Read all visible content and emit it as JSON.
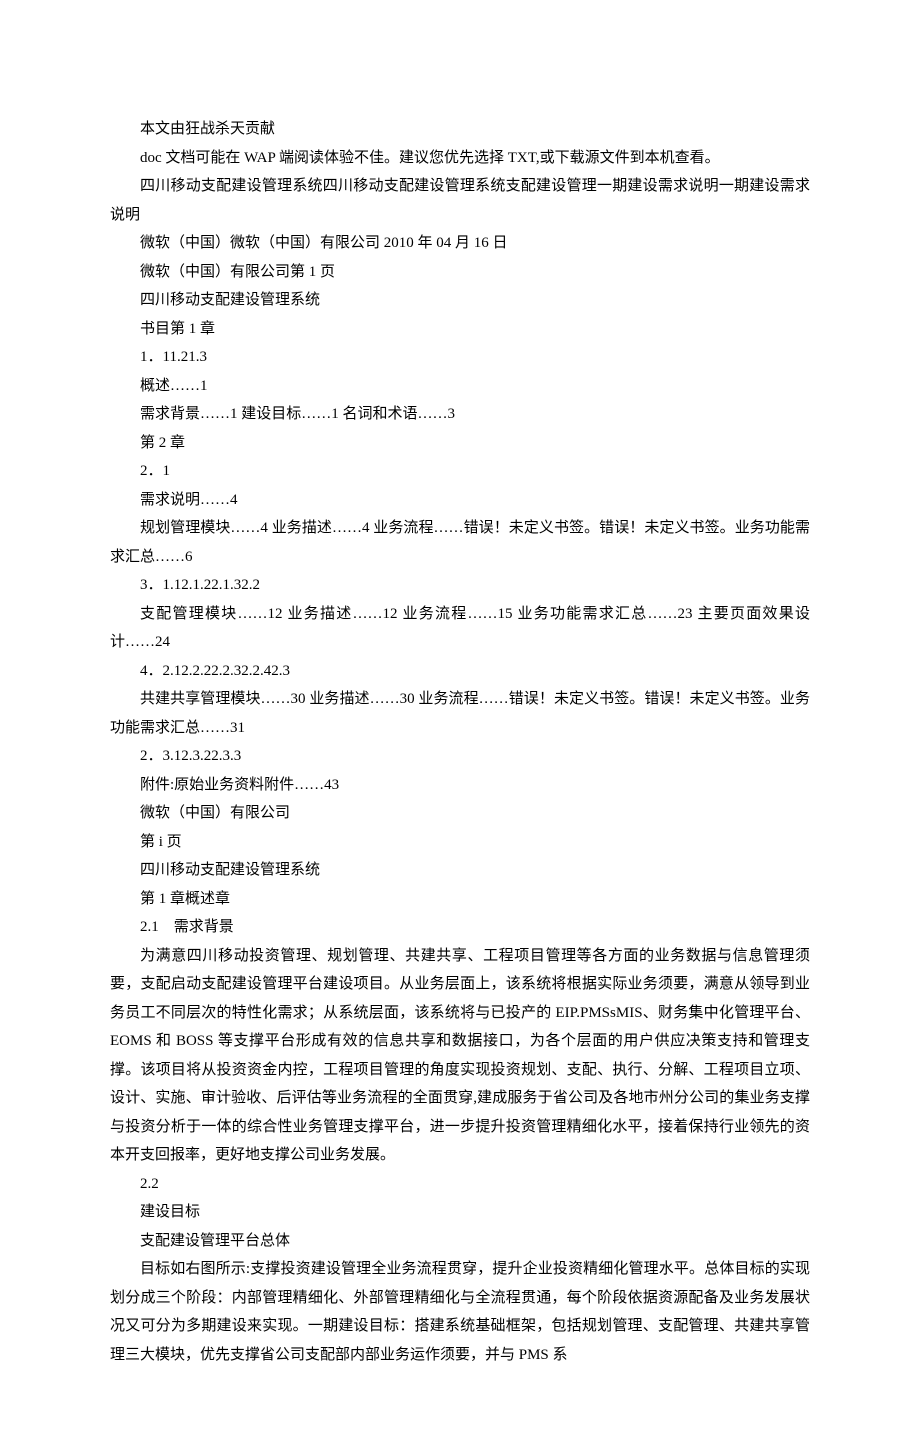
{
  "lines": [
    {
      "indent": true,
      "text": "本文由狂战杀天贡献"
    },
    {
      "indent": true,
      "text": "doc 文档可能在 WAP 端阅读体验不佳。建议您优先选择 TXT,或下载源文件到本机查看。"
    },
    {
      "indent": true,
      "text": "四川移动支配建设管理系统四川移动支配建设管理系统支配建设管理一期建设需求说明一期建设需求说明"
    },
    {
      "indent": true,
      "text": "微软（中国）微软（中国）有限公司 2010 年 04 月 16 日"
    },
    {
      "indent": true,
      "text": "微软（中国）有限公司第 1 页"
    },
    {
      "indent": true,
      "text": "四川移动支配建设管理系统"
    },
    {
      "indent": true,
      "text": "书目第 1 章"
    },
    {
      "indent": true,
      "text": "1．11.21.3"
    },
    {
      "indent": true,
      "text": "概述……1"
    },
    {
      "indent": true,
      "text": "需求背景……1 建设目标……1 名词和术语……3"
    },
    {
      "indent": true,
      "text": "第 2 章"
    },
    {
      "indent": true,
      "text": "2．1"
    },
    {
      "indent": true,
      "text": "需求说明……4"
    },
    {
      "indent": true,
      "text": "规划管理模块……4 业务描述……4 业务流程……错误！未定义书签。错误！未定义书签。业务功能需求汇总……6"
    },
    {
      "indent": true,
      "text": "3．1.12.1.22.1.32.2"
    },
    {
      "indent": true,
      "text": "支配管理模块……12 业务描述……12 业务流程……15 业务功能需求汇总……23 主要页面效果设计……24"
    },
    {
      "indent": true,
      "text": "4．2.12.2.22.2.32.2.42.3"
    },
    {
      "indent": true,
      "text": "共建共享管理模块……30 业务描述……30 业务流程……错误！未定义书签。错误！未定义书签。业务功能需求汇总……31"
    },
    {
      "indent": true,
      "text": "2．3.12.3.22.3.3"
    },
    {
      "indent": true,
      "text": "附件:原始业务资料附件……43"
    },
    {
      "indent": true,
      "text": "微软（中国）有限公司"
    },
    {
      "indent": true,
      "text": "第 i 页"
    },
    {
      "indent": true,
      "text": "四川移动支配建设管理系统"
    },
    {
      "indent": true,
      "text": "第 1 章概述章"
    },
    {
      "indent": true,
      "text": "2.1　需求背景"
    },
    {
      "indent": true,
      "text": "为满意四川移动投资管理、规划管理、共建共享、工程项目管理等各方面的业务数据与信息管理须要，支配启动支配建设管理平台建设项目。从业务层面上，该系统将根据实际业务须要，满意从领导到业务员工不同层次的特性化需求；从系统层面，该系统将与已投产的 EIP.PMSsMIS、财务集中化管理平台、EOMS 和 BOSS 等支撑平台形成有效的信息共享和数据接口，为各个层面的用户供应决策支持和管理支撑。该项目将从投资资金内控，工程项目管理的角度实现投资规划、支配、执行、分解、工程项目立项、设计、实施、审计验收、后评估等业务流程的全面贯穿,建成服务于省公司及各地市州分公司的集业务支撑与投资分析于一体的综合性业务管理支撑平台，进一步提升投资管理精细化水平，接着保持行业领先的资本开支回报率，更好地支撑公司业务发展。"
    },
    {
      "indent": true,
      "text": "2.2"
    },
    {
      "indent": true,
      "text": "建设目标"
    },
    {
      "indent": true,
      "text": "支配建设管理平台总体"
    },
    {
      "indent": true,
      "text": "目标如右图所示:支撑投资建设管理全业务流程贯穿，提升企业投资精细化管理水平。总体目标的实现划分成三个阶段：内部管理精细化、外部管理精细化与全流程贯通，每个阶段依据资源配备及业务发展状况又可分为多期建设来实现。一期建设目标：搭建系统基础框架，包括规划管理、支配管理、共建共享管理三大模块，优先支撑省公司支配部内部业务运作须要，并与 PMS 系"
    }
  ]
}
